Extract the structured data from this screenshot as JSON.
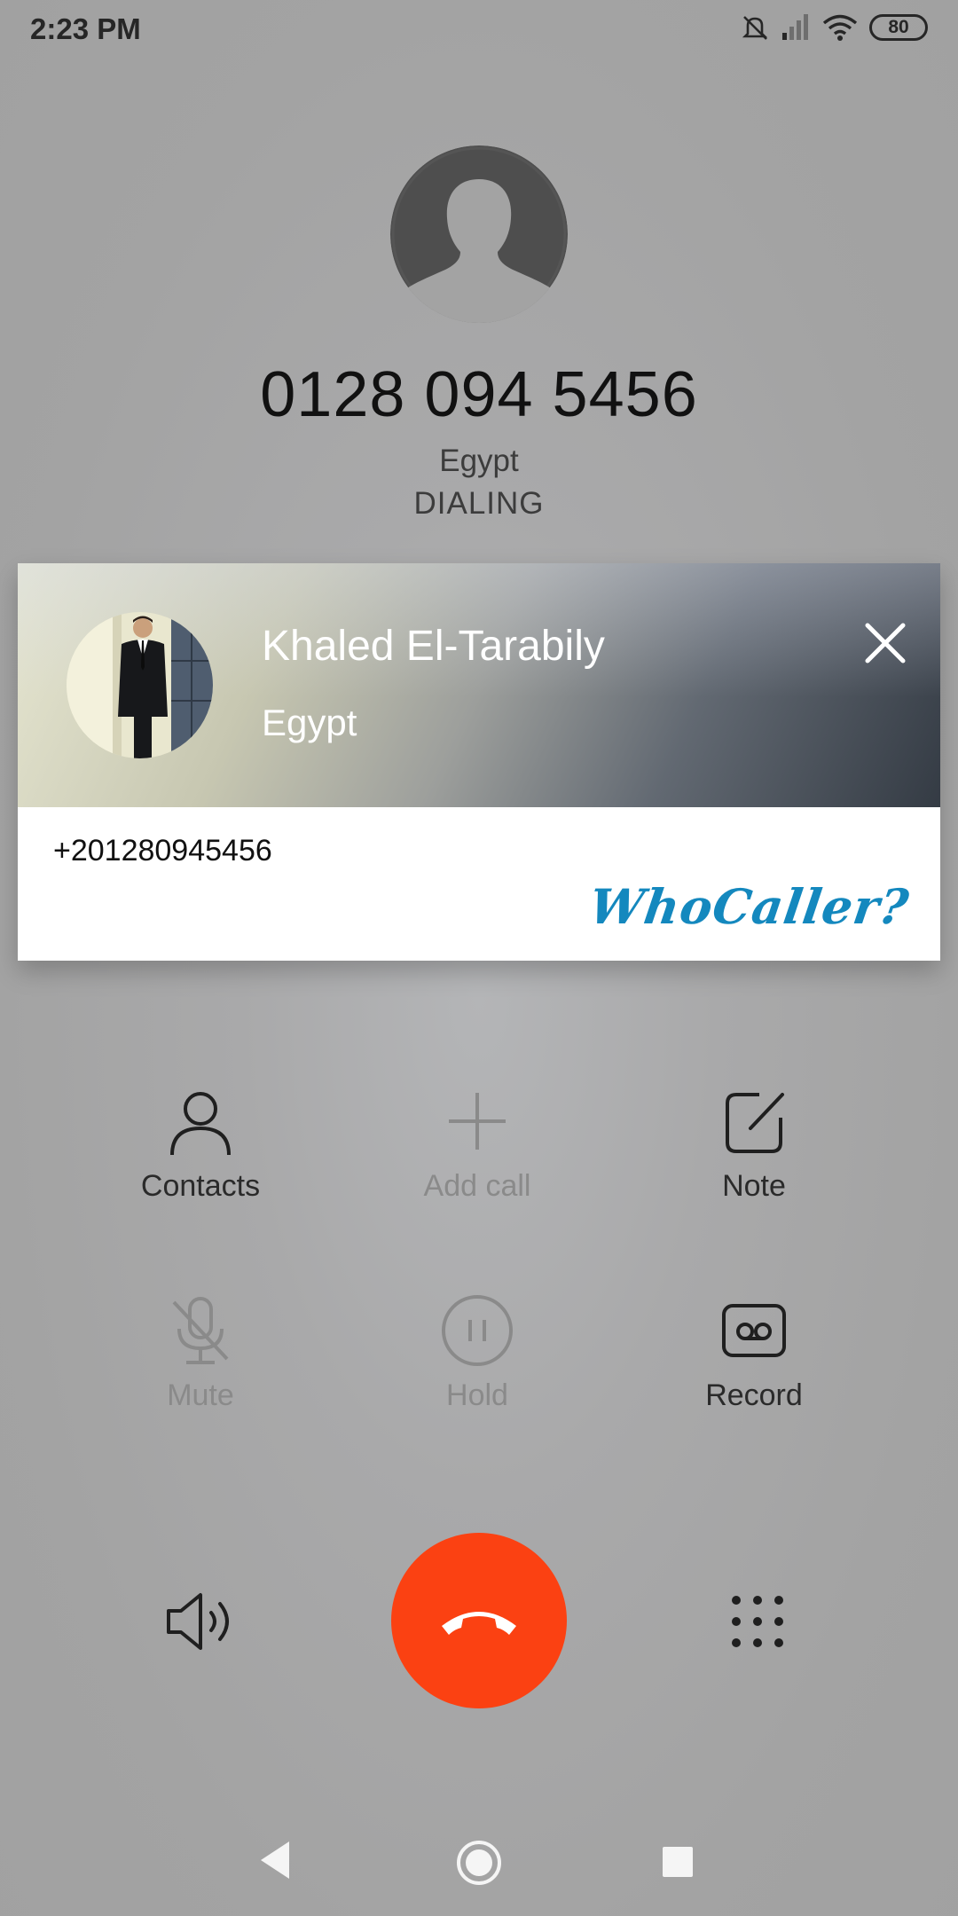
{
  "status_bar": {
    "time": "2:23 PM",
    "battery": "80",
    "icons": [
      "mute-icon",
      "signal-icon",
      "wifi-icon",
      "battery-icon"
    ]
  },
  "call": {
    "number": "0128 094 5456",
    "location": "Egypt",
    "state": "DIALING"
  },
  "caller_card": {
    "name": "Khaled El-Tarabily",
    "country": "Egypt",
    "phone": "+201280945456",
    "brand": "WhoCaller?",
    "brand_color": "#1488be"
  },
  "actions": {
    "contacts": "Contacts",
    "add_call": "Add call",
    "note": "Note",
    "mute": "Mute",
    "hold": "Hold",
    "record": "Record"
  },
  "colors": {
    "end_call": "#fb4112",
    "background": "#a3a3a3"
  }
}
